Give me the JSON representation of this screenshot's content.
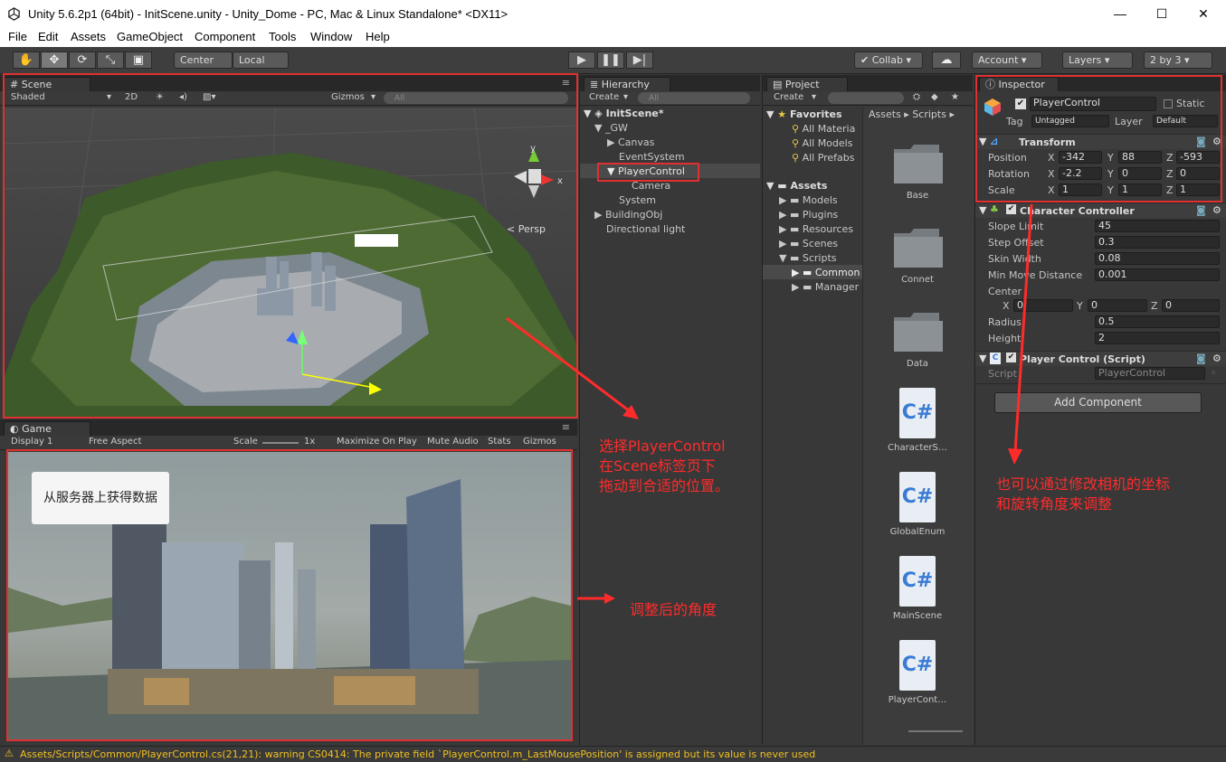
{
  "window": {
    "title": "Unity 5.6.2p1 (64bit) - InitScene.unity - Unity_Dome - PC, Mac & Linux Standalone* <DX11>",
    "minimize": "—",
    "maximize": "☐",
    "close": "✕"
  },
  "menu": [
    "File",
    "Edit",
    "Assets",
    "GameObject",
    "Component",
    "Tools",
    "Window",
    "Help"
  ],
  "toolbar": {
    "tools": [
      "hand-icon",
      "move-icon",
      "rotate-icon",
      "scale-icon",
      "rect-icon"
    ],
    "pivot": "Center",
    "space": "Local",
    "collab": "Collab",
    "account": "Account",
    "layers": "Layers",
    "layout": "2 by 3"
  },
  "scene": {
    "tab": "Scene",
    "shading": "Shaded",
    "mode2d": "2D",
    "gizmos": "Gizmos",
    "search_placeholder": "All",
    "persp": "Persp",
    "axis_y": "y",
    "axis_x": "x"
  },
  "game": {
    "tab": "Game",
    "display": "Display 1",
    "aspect": "Free Aspect",
    "scale_label": "Scale",
    "scale_value": "1x",
    "maximize": "Maximize On Play",
    "mute": "Mute Audio",
    "stats": "Stats",
    "gizmos": "Gizmos",
    "button": "从服务器上获得数据"
  },
  "hierarchy": {
    "tab": "Hierarchy",
    "create": "Create",
    "search_placeholder": "All",
    "scene_name": "InitScene*",
    "items": [
      "_GW",
      "Canvas",
      "EventSystem",
      "PlayerControl",
      "Camera",
      "System",
      "BuildingObj",
      "Directional light"
    ]
  },
  "project": {
    "tab": "Project",
    "create": "Create",
    "favorites_label": "Favorites",
    "favorites": [
      "All Materia",
      "All Models",
      "All Prefabs"
    ],
    "assets_label": "Assets",
    "assets": [
      "Models",
      "Plugins",
      "Resources",
      "Scenes",
      "Scripts"
    ],
    "scripts_children": [
      "Common",
      "Manager"
    ],
    "breadcrumb": [
      "Assets",
      "Scripts"
    ],
    "grid": [
      {
        "name": "Base",
        "kind": "folder"
      },
      {
        "name": "Connet",
        "kind": "folder"
      },
      {
        "name": "Data",
        "kind": "folder"
      },
      {
        "name": "CharacterS…",
        "kind": "cs"
      },
      {
        "name": "GlobalEnum",
        "kind": "cs"
      },
      {
        "name": "MainScene",
        "kind": "cs"
      },
      {
        "name": "PlayerCont…",
        "kind": "cs"
      }
    ],
    "cs_glyph": "C#"
  },
  "inspector": {
    "tab": "Inspector",
    "object_name": "PlayerControl",
    "static_label": "Static",
    "tag_label": "Tag",
    "tag_value": "Untagged",
    "layer_label": "Layer",
    "layer_value": "Default",
    "transform": {
      "title": "Transform",
      "position_label": "Position",
      "rotation_label": "Rotation",
      "scale_label": "Scale",
      "position": {
        "x": "-342",
        "y": "88",
        "z": "-593"
      },
      "rotation": {
        "x": "-2.2",
        "y": "0",
        "z": "0"
      },
      "scale": {
        "x": "1",
        "y": "1",
        "z": "1"
      }
    },
    "character_controller": {
      "title": "Character Controller",
      "slope_limit_label": "Slope Limit",
      "slope_limit": "45",
      "step_offset_label": "Step Offset",
      "step_offset": "0.3",
      "skin_width_label": "Skin Width",
      "skin_width": "0.08",
      "min_move_label": "Min Move Distance",
      "min_move": "0.001",
      "center_label": "Center",
      "center": {
        "x": "0",
        "y": "0",
        "z": "0"
      },
      "radius_label": "Radius",
      "radius": "0.5",
      "height_label": "Height",
      "height": "2"
    },
    "script": {
      "title": "Player Control (Script)",
      "script_label": "Script",
      "script_value": "PlayerControl"
    },
    "add_component": "Add Component",
    "axis": {
      "x": "X",
      "y": "Y",
      "z": "Z"
    }
  },
  "annotations": {
    "scene_note": [
      "选择PlayerControl",
      "在Scene标签页下",
      "拖动到合适的位置。"
    ],
    "game_note": "调整后的角度",
    "inspector_note": [
      "也可以通过修改相机的坐标",
      "和旋转角度来调整"
    ]
  },
  "status": "Assets/Scripts/Common/PlayerControl.cs(21,21): warning CS0414: The private field `PlayerControl.m_LastMousePosition' is assigned but its value is never used",
  "colors": {
    "accent_red": "#e03030",
    "selection": "#3e5f96"
  }
}
